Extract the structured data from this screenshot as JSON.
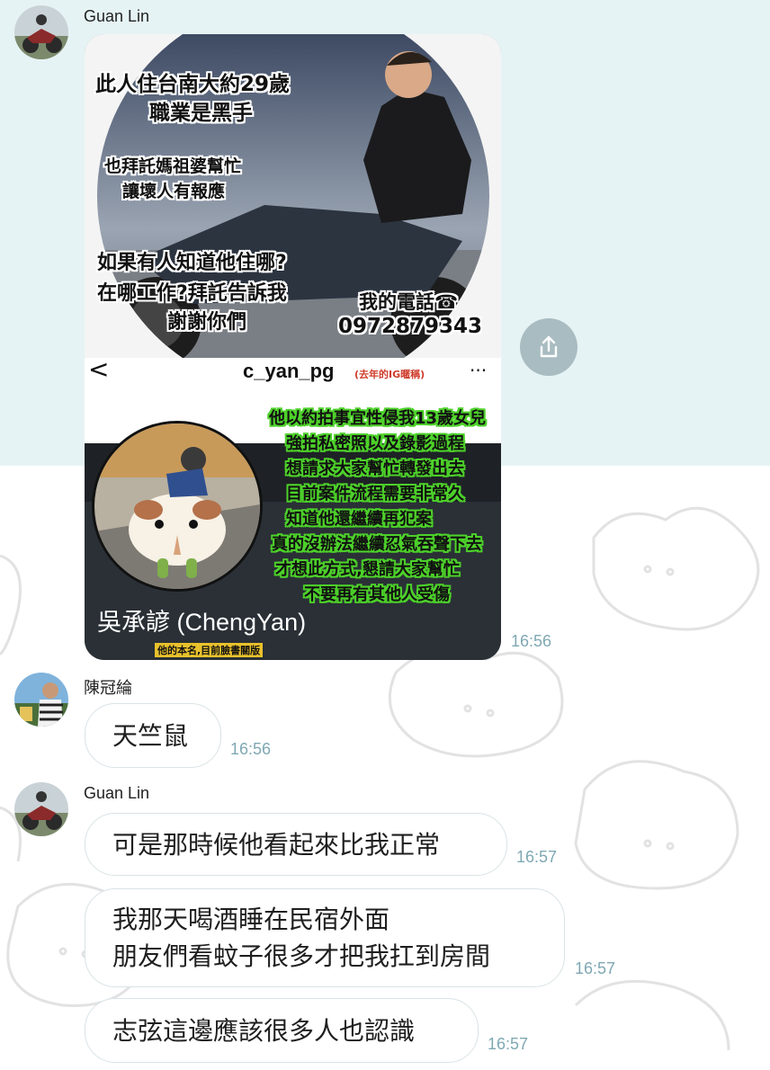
{
  "messages": [
    {
      "sender": "Guan Lin",
      "type": "image",
      "time": "16:56",
      "poster": {
        "lines_top_1": [
          "此人住台南大約29歲",
          "職業是黑手"
        ],
        "lines_top_2": [
          "也拜託媽祖婆幫忙",
          "讓壞人有報應"
        ],
        "lines_top_3": [
          "如果有人知道他住哪?",
          "在哪工作?拜託告訴我",
          "謝謝你們"
        ],
        "phone_label": "我的電話☎",
        "phone_number": "0972879343",
        "ig_back": "<",
        "ig_username": "c_yan_pg",
        "ig_username_note": "(去年的IG暱稱)",
        "ig_more": "···",
        "green_lines": [
          "他以約拍事宜性侵我13歲女兒",
          "強拍私密照以及錄影過程",
          "想請求大家幫忙轉發出去",
          "目前案件流程需要非常久",
          "知道他還繼續再犯案",
          "真的沒辦法繼續忍氣吞聲下去",
          "才想此方式,懇請大家幫忙",
          "不要再有其他人受傷"
        ],
        "display_name": "吳承諺 (ChengYan)",
        "display_name_note": "他的本名,目前臉書關版"
      }
    },
    {
      "sender": "陳冠綸",
      "type": "text",
      "text": "天竺鼠",
      "time": "16:56"
    },
    {
      "sender": "Guan Lin",
      "type": "text",
      "text": "可是那時候他看起來比我正常",
      "time": "16:57"
    },
    {
      "type": "text",
      "text": "我那天喝酒睡在民宿外面\n朋友們看蚊子很多才把我扛到房間",
      "time": "16:57"
    },
    {
      "type": "text",
      "text": "志弦這邊應該很多人也認識",
      "time": "16:57"
    }
  ]
}
